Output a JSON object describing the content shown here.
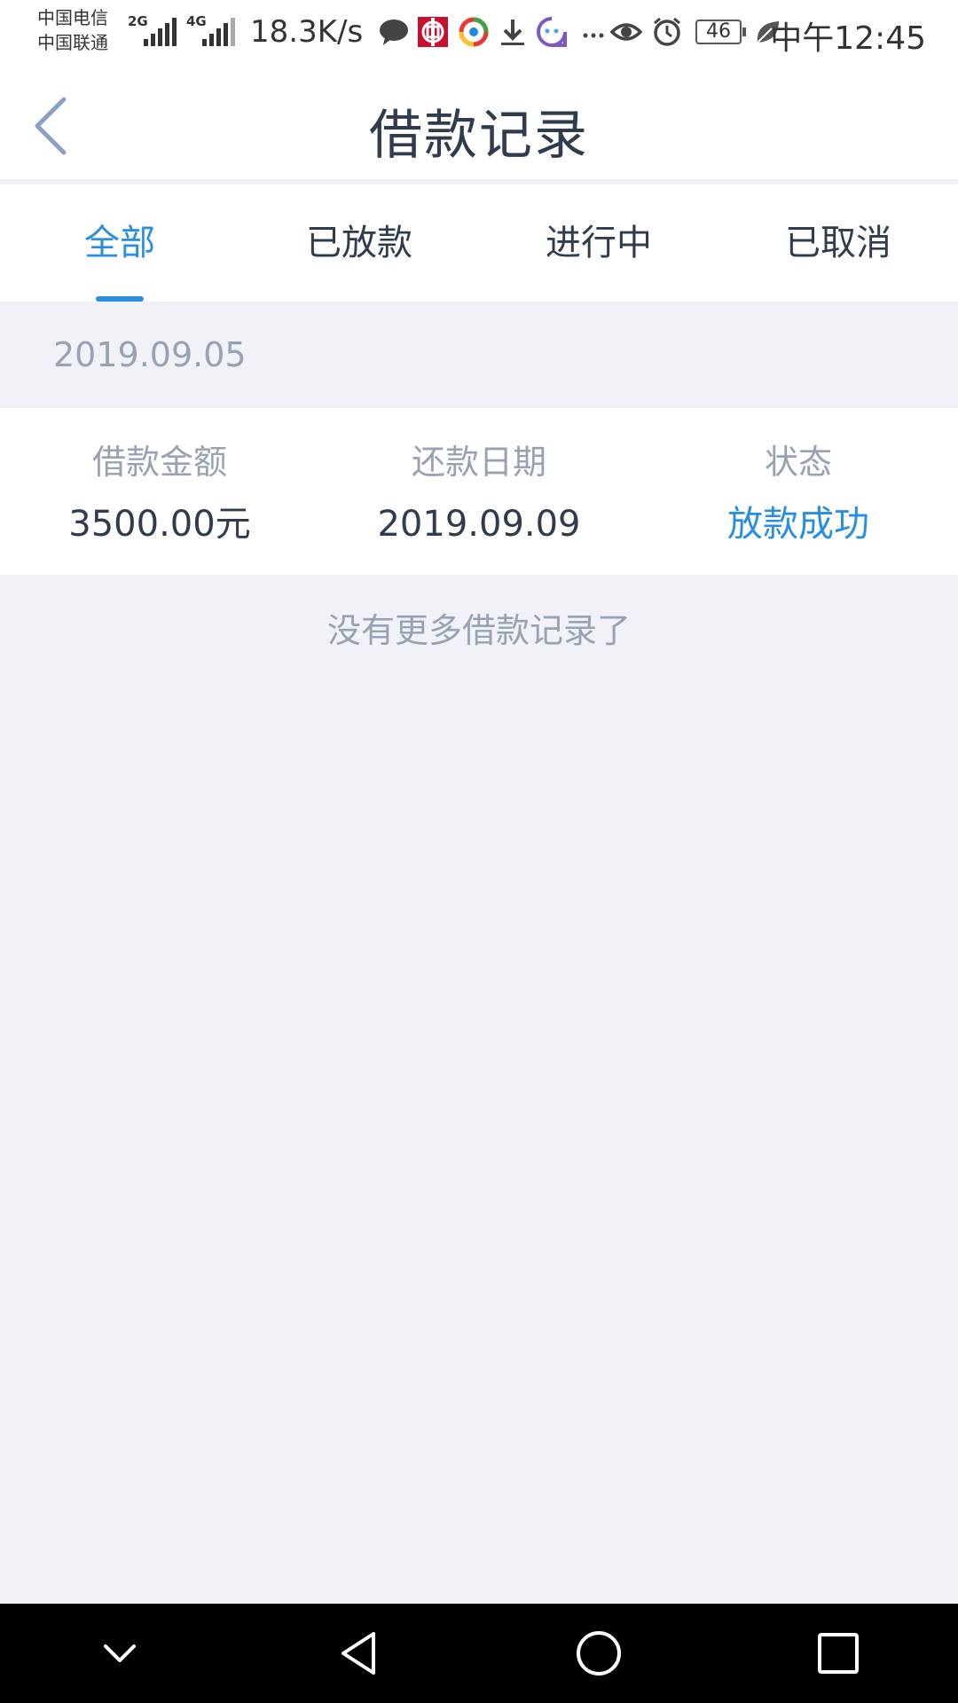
{
  "status_bar": {
    "carrier_1": "中国电信",
    "carrier_2": "中国联通",
    "net_type_1": "2G",
    "net_type_2": "4G",
    "speed": "18.3K/s",
    "battery": "46",
    "time": "中午12:45",
    "icons": [
      "message-icon",
      "bank-icon",
      "browser-icon",
      "download-icon",
      "chat-app-icon",
      "more-icon",
      "eye-icon",
      "alarm-icon",
      "leaf-icon"
    ]
  },
  "header": {
    "title": "借款记录"
  },
  "tabs": [
    {
      "label": "全部",
      "active": true
    },
    {
      "label": "已放款",
      "active": false
    },
    {
      "label": "进行中",
      "active": false
    },
    {
      "label": "已取消",
      "active": false
    }
  ],
  "records": [
    {
      "date": "2019.09.05",
      "amount_label": "借款金额",
      "amount": "3500.00元",
      "due_label": "还款日期",
      "due_date": "2019.09.09",
      "status_label": "状态",
      "status": "放款成功"
    }
  ],
  "footer_text": "没有更多借款记录了",
  "colors": {
    "accent": "#2a8ee0",
    "title_text": "#2f3c4d",
    "muted_text": "#98a2b3",
    "background": "#f0f2f7"
  }
}
